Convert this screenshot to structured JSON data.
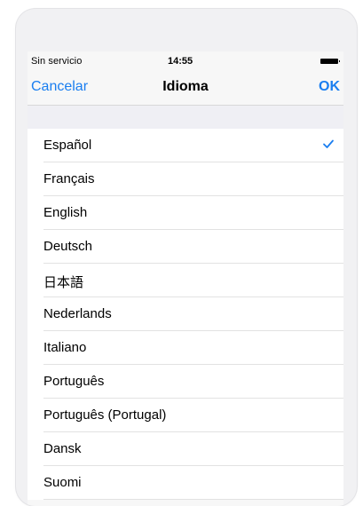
{
  "status_bar": {
    "carrier": "Sin servicio",
    "time": "14:55",
    "battery": "battery-full-icon"
  },
  "nav": {
    "cancel_label": "Cancelar",
    "title": "Idioma",
    "ok_label": "OK"
  },
  "languages": {
    "selected": "Español",
    "items": [
      {
        "label": "Español",
        "checked": true
      },
      {
        "label": "Français"
      },
      {
        "label": "English"
      },
      {
        "label": "Deutsch"
      },
      {
        "label": "日本語"
      },
      {
        "label": "Nederlands"
      },
      {
        "label": "Italiano"
      },
      {
        "label": "Português"
      },
      {
        "label": "Português (Portugal)"
      },
      {
        "label": "Dansk"
      },
      {
        "label": "Suomi"
      }
    ]
  },
  "colors": {
    "accent": "#1a7ef0",
    "background": "#f7f7f7",
    "list_background": "#ffffff",
    "separator": "#e2e2e2"
  }
}
